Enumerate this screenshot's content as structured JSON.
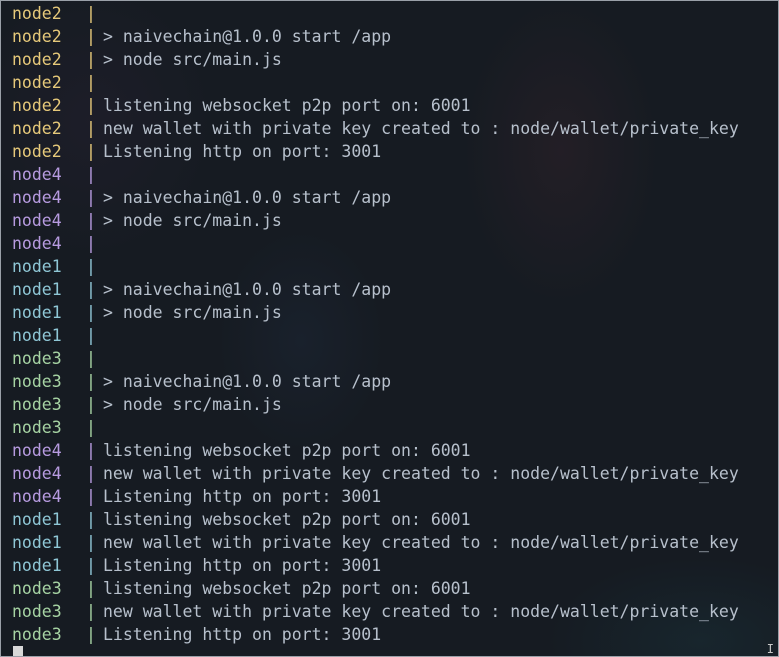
{
  "terminal": {
    "lines": [
      {
        "node": "node2",
        "sep": "|",
        "text": ""
      },
      {
        "node": "node2",
        "sep": "|",
        "text": "> naivechain@1.0.0 start /app"
      },
      {
        "node": "node2",
        "sep": "|",
        "text": "> node src/main.js"
      },
      {
        "node": "node2",
        "sep": "|",
        "text": ""
      },
      {
        "node": "node2",
        "sep": "|",
        "text": "listening websocket p2p port on: 6001"
      },
      {
        "node": "node2",
        "sep": "|",
        "text": "new wallet with private key created to : node/wallet/private_key"
      },
      {
        "node": "node2",
        "sep": "|",
        "text": "Listening http on port: 3001"
      },
      {
        "node": "node4",
        "sep": "|",
        "text": ""
      },
      {
        "node": "node4",
        "sep": "|",
        "text": "> naivechain@1.0.0 start /app"
      },
      {
        "node": "node4",
        "sep": "|",
        "text": "> node src/main.js"
      },
      {
        "node": "node4",
        "sep": "|",
        "text": ""
      },
      {
        "node": "node1",
        "sep": "|",
        "text": ""
      },
      {
        "node": "node1",
        "sep": "|",
        "text": "> naivechain@1.0.0 start /app"
      },
      {
        "node": "node1",
        "sep": "|",
        "text": "> node src/main.js"
      },
      {
        "node": "node1",
        "sep": "|",
        "text": ""
      },
      {
        "node": "node3",
        "sep": "|",
        "text": ""
      },
      {
        "node": "node3",
        "sep": "|",
        "text": "> naivechain@1.0.0 start /app"
      },
      {
        "node": "node3",
        "sep": "|",
        "text": "> node src/main.js"
      },
      {
        "node": "node3",
        "sep": "|",
        "text": ""
      },
      {
        "node": "node4",
        "sep": "|",
        "text": "listening websocket p2p port on: 6001"
      },
      {
        "node": "node4",
        "sep": "|",
        "text": "new wallet with private key created to : node/wallet/private_key"
      },
      {
        "node": "node4",
        "sep": "|",
        "text": "Listening http on port: 3001"
      },
      {
        "node": "node1",
        "sep": "|",
        "text": "listening websocket p2p port on: 6001"
      },
      {
        "node": "node1",
        "sep": "|",
        "text": "new wallet with private key created to : node/wallet/private_key"
      },
      {
        "node": "node1",
        "sep": "|",
        "text": "Listening http on port: 3001"
      },
      {
        "node": "node3",
        "sep": "|",
        "text": "listening websocket p2p port on: 6001"
      },
      {
        "node": "node3",
        "sep": "|",
        "text": "new wallet with private key created to : node/wallet/private_key"
      },
      {
        "node": "node3",
        "sep": "|",
        "text": "Listening http on port: 3001"
      }
    ]
  },
  "colors": {
    "node2": "#e6c97a",
    "node4": "#b79be0",
    "node1": "#8fc7d6",
    "node3": "#a6d3a3",
    "message": "#b7c0cc",
    "background": "#161b22"
  },
  "icons": {
    "cursor": "block-cursor-icon",
    "resize": "text-cursor-icon"
  },
  "resize_glyph": "I"
}
